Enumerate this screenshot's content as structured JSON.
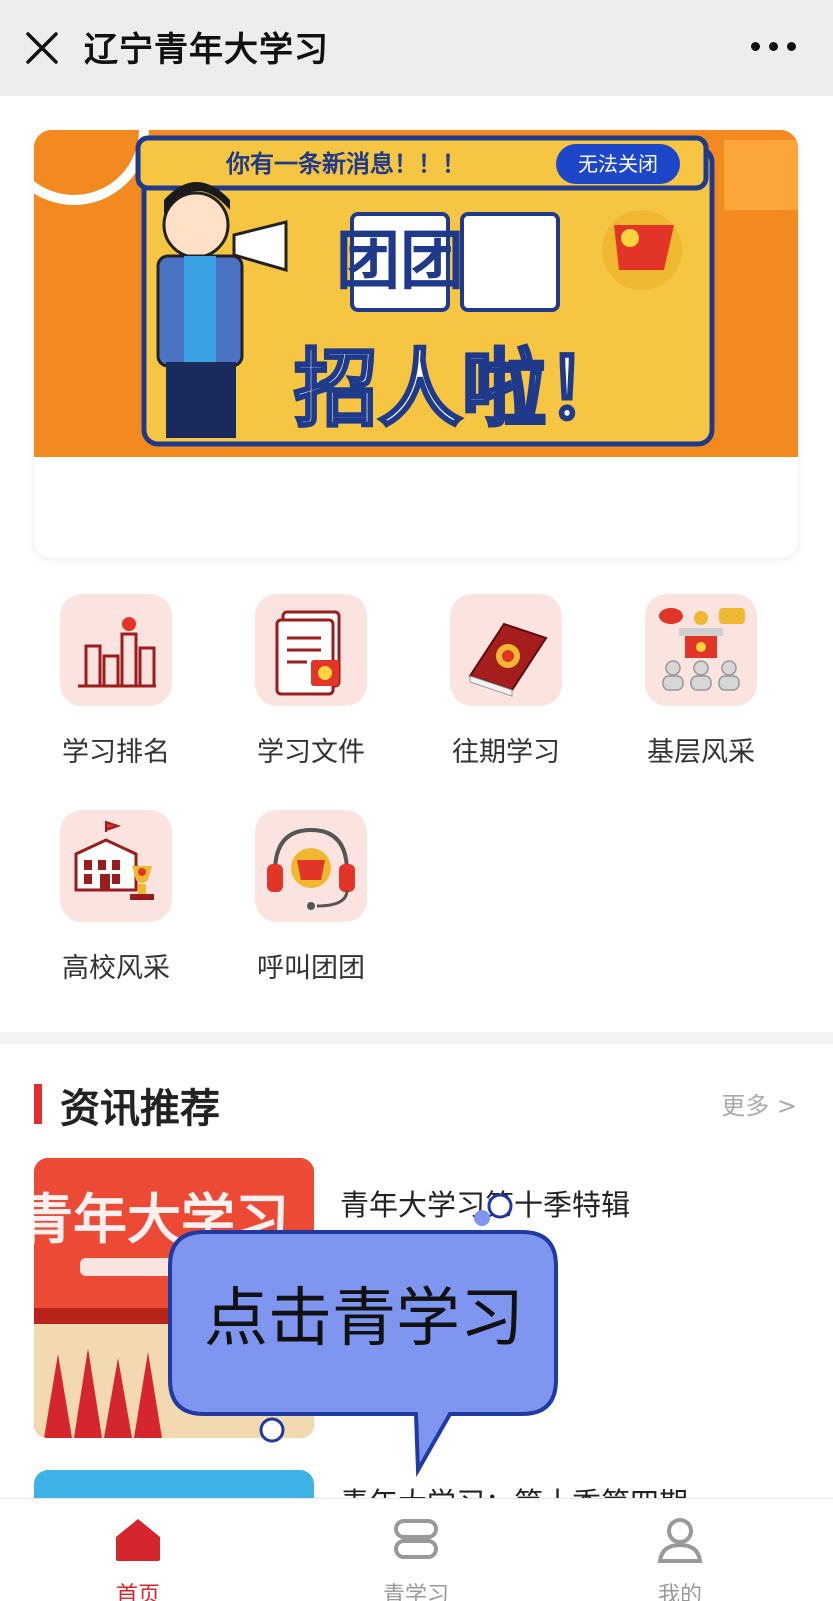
{
  "window": {
    "title": "辽宁青年大学习"
  },
  "banner": {
    "message": "你有一条新消息！！！",
    "badge": "无法关闭",
    "headline_line1": "团团",
    "headline_line2": "招人啦！"
  },
  "menu": {
    "items": [
      {
        "label": "学习排名",
        "icon": "ranking-chart-icon"
      },
      {
        "label": "学习文件",
        "icon": "documents-icon"
      },
      {
        "label": "往期学习",
        "icon": "book-icon"
      },
      {
        "label": "基层风采",
        "icon": "meeting-icon"
      },
      {
        "label": "高校风采",
        "icon": "campus-building-icon"
      },
      {
        "label": "呼叫团团",
        "icon": "headset-icon"
      }
    ]
  },
  "news": {
    "section_title": "资讯推荐",
    "more_label": "更多 >",
    "items": [
      {
        "title": "青年大学习第十季特辑",
        "thumb_text": "青年大学习"
      },
      {
        "title": "青年大学习：第十季第四期"
      }
    ]
  },
  "tip": {
    "text": "点击青学习"
  },
  "tabbar": {
    "tabs": [
      {
        "label": "首页",
        "icon": "home-icon",
        "active": true
      },
      {
        "label": "青学习",
        "icon": "study-icon",
        "active": false
      },
      {
        "label": "我的",
        "icon": "profile-icon",
        "active": false
      }
    ]
  },
  "colors": {
    "accent": "#d6262d",
    "banner_orange": "#f28a1f",
    "banner_yellow": "#f6c542",
    "tile_bg": "#fbe4df",
    "tip_blue": "#7f96f1"
  }
}
